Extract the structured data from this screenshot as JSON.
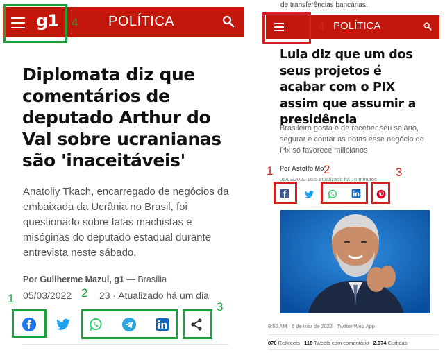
{
  "left": {
    "header": {
      "logo": "g1",
      "section": "POLÍTICA"
    },
    "headline": "Diplomata diz que comentários de deputado Arthur do Val sobre ucranianas são 'inaceitáveis'",
    "summary": "Anatoliy Tkach, encarregado de negócios da embaixada da Ucrânia no Brasil, foi questionado sobre falas machistas e misóginas do deputado estadual durante entrevista neste sábado.",
    "author_prefix": "Por",
    "author_name": "Guilherme Mazui, g1",
    "author_place": " — Brasília",
    "date": "05/03/2022",
    "date_hidden": "23 · Atualizado há um dia",
    "share_icons": [
      "facebook-icon",
      "twitter-icon",
      "whatsapp-icon",
      "telegram-icon",
      "linkedin-icon",
      "share-icon"
    ]
  },
  "right": {
    "cut_text": "de transferências bancárias.",
    "header": {
      "section": "POLÍTICA"
    },
    "headline": "Lula diz que um dos seus projetos é acabar com o PIX assim que assumir a presidência",
    "summary": "Brasileiro gosta é de receber seu salário, segurar e contar as notas esse negócio de Pix só favorece milicianos",
    "author": "Por Astolfo Mo",
    "date": "05/03/2022 15:5  atualizado há 16 minutos",
    "caption": "8:50 AM · 6 de mar de 2022 · Twitter Web App",
    "stats": {
      "retweets_count": "878",
      "retweets_label": "Retweets",
      "quotes_count": "118",
      "quotes_label": "Tweets com comentário",
      "likes_count": "2.074",
      "likes_label": "Curtidas"
    },
    "share_icons": [
      "facebook-icon",
      "twitter-icon",
      "whatsapp-icon",
      "linkedin-icon",
      "pinterest-icon"
    ]
  },
  "annotations": {
    "left": [
      "1",
      "2",
      "3",
      "4"
    ],
    "right": [
      "1",
      "2",
      "3",
      "4"
    ],
    "colors": {
      "left": "#1aa33b",
      "right": "#d42020"
    }
  },
  "colors": {
    "brand_red": "#c4170c",
    "facebook": "#1877f2",
    "twitter": "#1da1f2",
    "whatsapp": "#25d366",
    "telegram": "#2aa3df",
    "linkedin": "#0a66c2",
    "pinterest": "#e60023"
  }
}
